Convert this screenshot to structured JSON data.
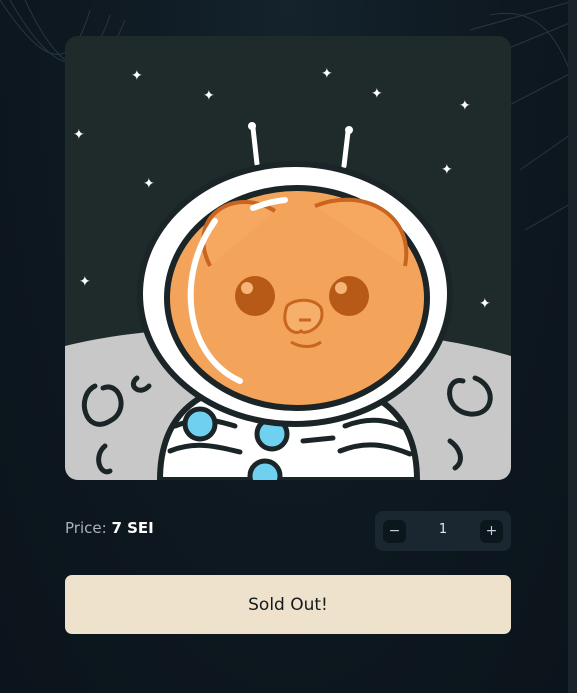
{
  "nft": {
    "image_alt": "Astronaut bunny in space suit with orange helmet on the moon"
  },
  "price": {
    "label": "Price:",
    "value": "7 SEI"
  },
  "quantity": {
    "decrement": "−",
    "value": "1",
    "increment": "+"
  },
  "buy_button": {
    "label": "Sold Out!"
  },
  "colors": {
    "background": "#0f1a22",
    "button": "#eee2cd",
    "helmet": "#f4a35a"
  }
}
